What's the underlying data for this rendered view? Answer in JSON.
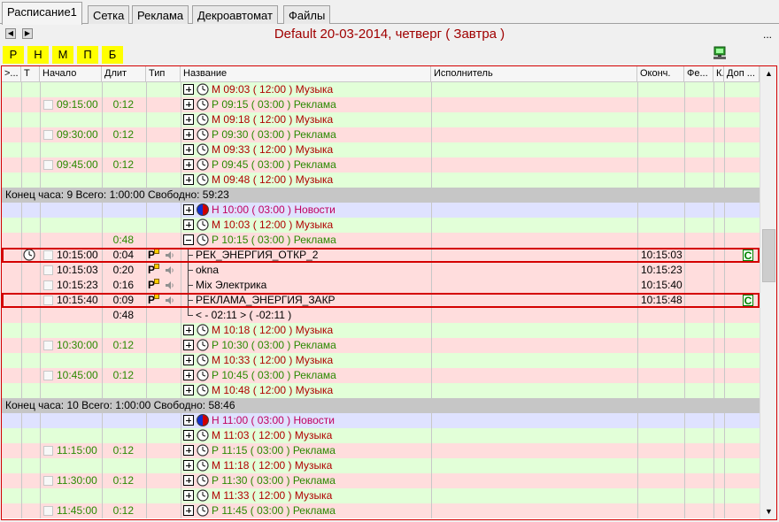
{
  "tabs": [
    {
      "label": "Расписание1",
      "active": true
    },
    {
      "label": "Сетка",
      "active": false
    },
    {
      "label": "Реклама",
      "active": false
    },
    {
      "label": "Декроавтомат",
      "active": false
    },
    {
      "label": "Файлы",
      "active": false
    }
  ],
  "nav": {
    "prev": "◀",
    "next": "▶",
    "title": "Default 20-03-2014, четверг ( Завтра )",
    "more": "..."
  },
  "filters": [
    "Р",
    "Н",
    "М",
    "П",
    "Б"
  ],
  "columns": [
    ">...",
    "Т",
    "Начало",
    "Длит",
    "Тип",
    "Название",
    "Исполнитель",
    "Оконч.",
    "Фе...",
    "К..",
    "Доп ..."
  ],
  "rows": [
    {
      "kind": "item",
      "bg": "green",
      "time": "",
      "dur": "",
      "icon": "clock",
      "expand": "plus",
      "text": "М 09:03 ( 12:00 ) Музыка",
      "cls": "music"
    },
    {
      "kind": "item",
      "bg": "pink",
      "time": "09:15:00",
      "dur": "0:12",
      "icon": "clock",
      "expand": "plus",
      "text": "Р 09:15 ( 03:00 ) Реклама",
      "cls": "ad"
    },
    {
      "kind": "item",
      "bg": "green",
      "time": "",
      "dur": "",
      "icon": "clock",
      "expand": "plus",
      "text": "М 09:18 ( 12:00 ) Музыка",
      "cls": "music"
    },
    {
      "kind": "item",
      "bg": "pink",
      "time": "09:30:00",
      "dur": "0:12",
      "icon": "clock",
      "expand": "plus",
      "text": "Р 09:30 ( 03:00 ) Реклама",
      "cls": "ad"
    },
    {
      "kind": "item",
      "bg": "green",
      "time": "",
      "dur": "",
      "icon": "clock",
      "expand": "plus",
      "text": "М 09:33 ( 12:00 ) Музыка",
      "cls": "music"
    },
    {
      "kind": "item",
      "bg": "pink",
      "time": "09:45:00",
      "dur": "0:12",
      "icon": "clock",
      "expand": "plus",
      "text": "Р 09:45 ( 03:00 ) Реклама",
      "cls": "ad"
    },
    {
      "kind": "item",
      "bg": "green",
      "time": "",
      "dur": "",
      "icon": "clock",
      "expand": "plus",
      "text": "М 09:48 ( 12:00 ) Музыка",
      "cls": "music"
    },
    {
      "kind": "summary",
      "text": "Конец часа: 9 Всего: 1:00:00 Свободно: 59:23"
    },
    {
      "kind": "item",
      "bg": "blue",
      "time": "",
      "dur": "",
      "icon": "news",
      "expand": "plus",
      "text": "Н 10:00 ( 03:00 ) Новости",
      "cls": "newsc"
    },
    {
      "kind": "item",
      "bg": "green",
      "time": "",
      "dur": "",
      "icon": "clock",
      "expand": "plus",
      "text": "М 10:03 ( 12:00 ) Музыка",
      "cls": "music"
    },
    {
      "kind": "item",
      "bg": "pink",
      "time": "",
      "dur": "0:48",
      "icon": "clock",
      "expand": "minus",
      "text": "Р 10:15 ( 03:00 ) Реклама",
      "cls": "ad"
    },
    {
      "kind": "track",
      "bg": "pink",
      "time": "10:15:00",
      "dur": "0:04",
      "type": "Р",
      "text": "РЕК_ЭНЕРГИЯ_ОТКР_2",
      "end": "10:15:03",
      "mark": "C",
      "highlight": true,
      "clock": true
    },
    {
      "kind": "track",
      "bg": "pink",
      "time": "10:15:03",
      "dur": "0:20",
      "type": "Р",
      "text": "okna",
      "end": "10:15:23",
      "mark": "",
      "highlight": false,
      "clock": false
    },
    {
      "kind": "track",
      "bg": "pink",
      "time": "10:15:23",
      "dur": "0:16",
      "type": "Р",
      "text": "Mix Электрика",
      "end": "10:15:40",
      "mark": "",
      "highlight": false,
      "clock": false
    },
    {
      "kind": "track",
      "bg": "pink",
      "time": "10:15:40",
      "dur": "0:09",
      "type": "Р",
      "text": "РЕКЛАМА_ЭНЕРГИЯ_ЗАКР",
      "end": "10:15:48",
      "mark": "C",
      "highlight": true,
      "clock": false
    },
    {
      "kind": "free",
      "bg": "pink",
      "dur": "0:48",
      "text": "< - 02:11 > ( -02:11 )"
    },
    {
      "kind": "item",
      "bg": "green",
      "time": "",
      "dur": "",
      "icon": "clock",
      "expand": "plus",
      "text": "М 10:18 ( 12:00 ) Музыка",
      "cls": "music"
    },
    {
      "kind": "item",
      "bg": "pink",
      "time": "10:30:00",
      "dur": "0:12",
      "icon": "clock",
      "expand": "plus",
      "text": "Р 10:30 ( 03:00 ) Реклама",
      "cls": "ad"
    },
    {
      "kind": "item",
      "bg": "green",
      "time": "",
      "dur": "",
      "icon": "clock",
      "expand": "plus",
      "text": "М 10:33 ( 12:00 ) Музыка",
      "cls": "music"
    },
    {
      "kind": "item",
      "bg": "pink",
      "time": "10:45:00",
      "dur": "0:12",
      "icon": "clock",
      "expand": "plus",
      "text": "Р 10:45 ( 03:00 ) Реклама",
      "cls": "ad"
    },
    {
      "kind": "item",
      "bg": "green",
      "time": "",
      "dur": "",
      "icon": "clock",
      "expand": "plus",
      "text": "М 10:48 ( 12:00 ) Музыка",
      "cls": "music"
    },
    {
      "kind": "summary",
      "text": "Конец часа: 10 Всего: 1:00:00 Свободно: 58:46"
    },
    {
      "kind": "item",
      "bg": "blue",
      "time": "",
      "dur": "",
      "icon": "news",
      "expand": "plus",
      "text": "Н 11:00 ( 03:00 ) Новости",
      "cls": "newsc"
    },
    {
      "kind": "item",
      "bg": "green",
      "time": "",
      "dur": "",
      "icon": "clock",
      "expand": "plus",
      "text": "М 11:03 ( 12:00 ) Музыка",
      "cls": "music"
    },
    {
      "kind": "item",
      "bg": "pink",
      "time": "11:15:00",
      "dur": "0:12",
      "icon": "clock",
      "expand": "plus",
      "text": "Р 11:15 ( 03:00 ) Реклама",
      "cls": "ad"
    },
    {
      "kind": "item",
      "bg": "green",
      "time": "",
      "dur": "",
      "icon": "clock",
      "expand": "plus",
      "text": "М 11:18 ( 12:00 ) Музыка",
      "cls": "music"
    },
    {
      "kind": "item",
      "bg": "pink",
      "time": "11:30:00",
      "dur": "0:12",
      "icon": "clock",
      "expand": "plus",
      "text": "Р 11:30 ( 03:00 ) Реклама",
      "cls": "ad"
    },
    {
      "kind": "item",
      "bg": "green",
      "time": "",
      "dur": "",
      "icon": "clock",
      "expand": "plus",
      "text": "М 11:33 ( 12:00 ) Музыка",
      "cls": "music"
    },
    {
      "kind": "item",
      "bg": "pink",
      "time": "11:45:00",
      "dur": "0:12",
      "icon": "clock",
      "expand": "plus",
      "text": "Р 11:45 ( 03:00 ) Реклама",
      "cls": "ad"
    }
  ],
  "icons": {
    "clock": "clock-icon",
    "news": "news-icon",
    "speaker": "speaker-icon",
    "monitor": "monitor-icon",
    "scroll_up": "▲",
    "scroll_down": "▼"
  },
  "colors": {
    "music": "#b00000",
    "ad": "#2a8a00",
    "news": "#c00060",
    "title": "#a00000",
    "filter_bg": "#ffff00",
    "highlight": "#d40000"
  }
}
